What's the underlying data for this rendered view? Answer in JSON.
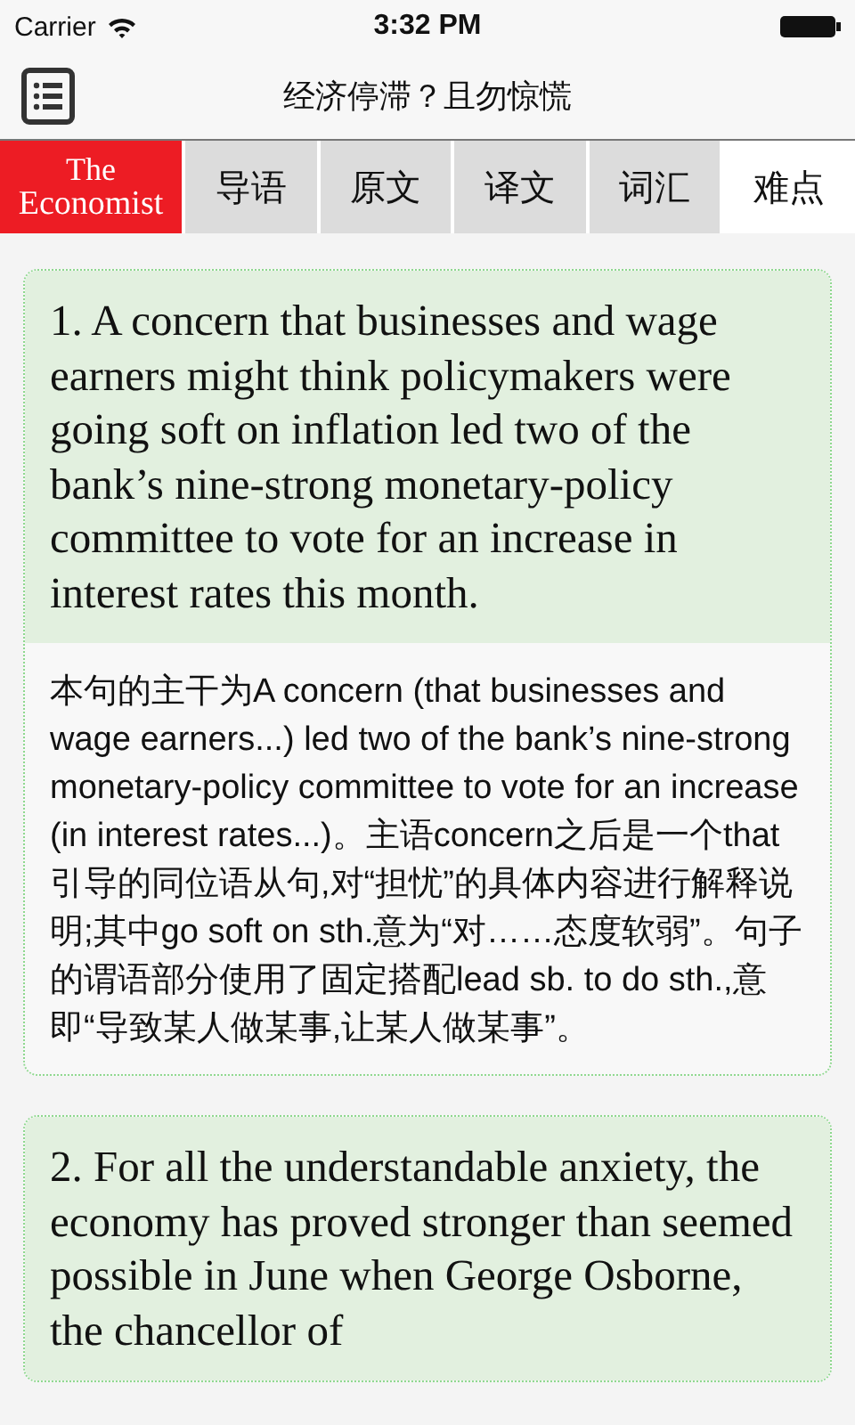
{
  "status_bar": {
    "carrier": "Carrier",
    "time": "3:32 PM"
  },
  "nav": {
    "title": "经济停滞？且勿惊慌"
  },
  "logo": {
    "line_1": "The",
    "line_2": "Economist"
  },
  "tabs": [
    {
      "label": "导语",
      "selected": false
    },
    {
      "label": "原文",
      "selected": false
    },
    {
      "label": "译文",
      "selected": false
    },
    {
      "label": "词汇",
      "selected": false
    },
    {
      "label": "难点",
      "selected": true
    }
  ],
  "cards": [
    {
      "sentence": "1. A concern that businesses and wage earners might think policymakers were going soft on inflation led two of the bank’s nine-strong monetary-policy committee to vote for an increase in interest rates this month.",
      "explanation": "本句的主干为A concern (that businesses and wage earners...) led two of the bank’s nine-strong monetary-policy committee to vote for an increase (in interest rates...)。主语concern之后是一个that 引导的同位语从句,对“担忧”的具体内容进行解释说明;其中go soft on sth.意为“对……态度软弱”。句子的谓语部分使用了固定搭配lead sb. to do sth.,意即“导致某人做某事,让某人做某事”。"
    },
    {
      "sentence": "2. For all the understandable anxiety, the economy has proved stronger than seemed possible in June when George Osborne, the chancellor of"
    }
  ]
}
